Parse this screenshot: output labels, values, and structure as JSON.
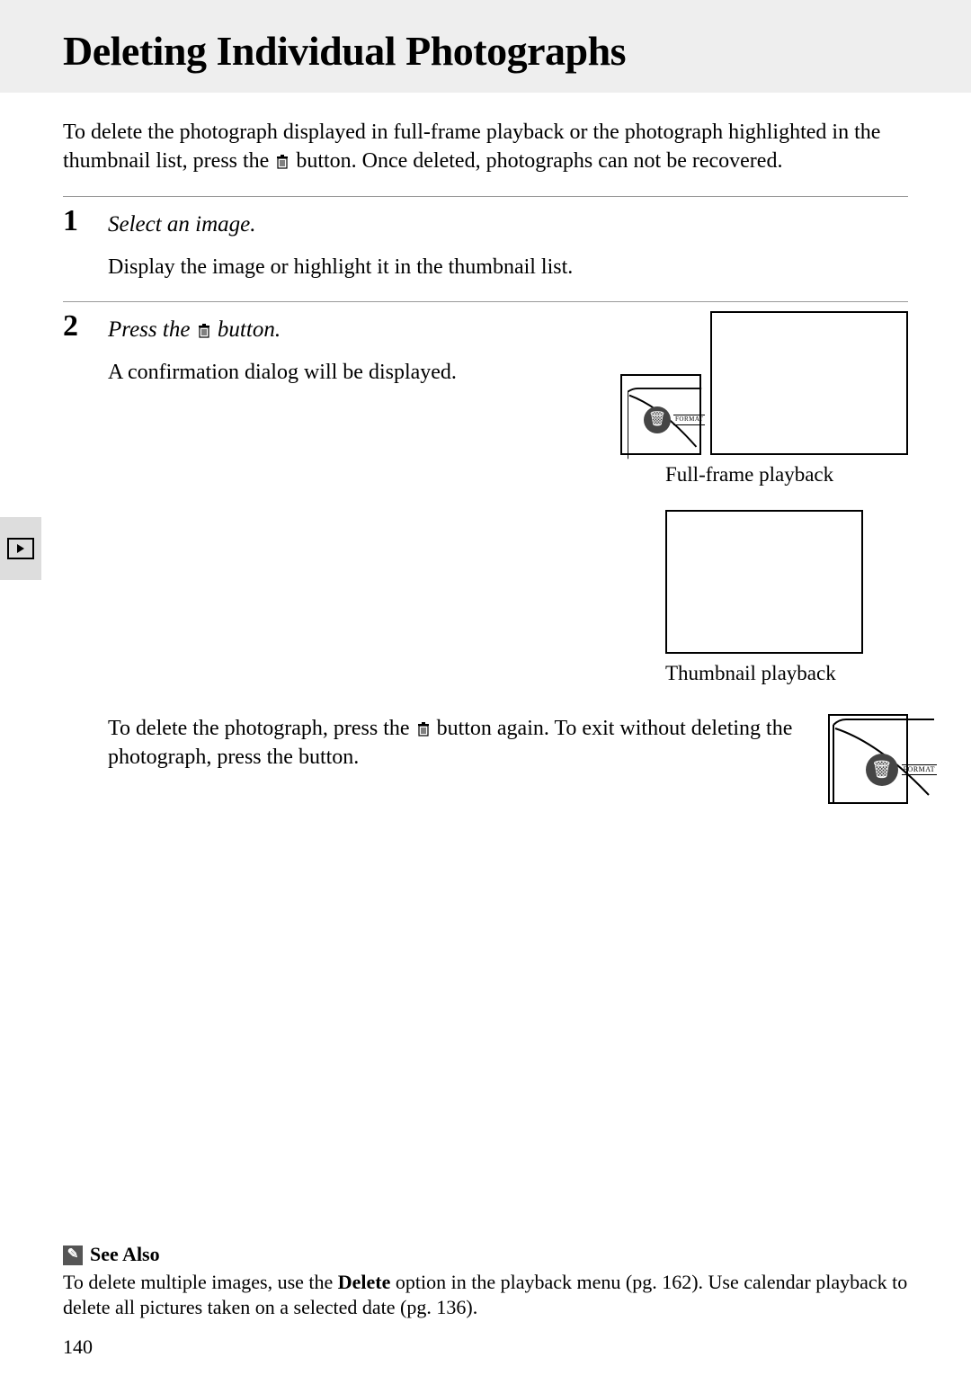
{
  "title": "Deleting Individual Photographs",
  "intro_part1": "To delete the photograph displayed in full-frame playback or the photograph highlighted in the thumbnail list, press the ",
  "intro_part2": " button.  Once deleted, photographs can not be recovered.",
  "steps": {
    "s1": {
      "num": "1",
      "title": "Select an image.",
      "body": "Display the image or highlight it in the thumbnail list."
    },
    "s2": {
      "num": "2",
      "title_pre": "Press the  ",
      "title_post": " button.",
      "body": "A confirmation dialog will be displayed.",
      "caption1": "Full-frame playback",
      "caption2": "Thumbnail playback",
      "cont_pre": "To delete the photograph, press the ",
      "cont_mid": " button again.  To exit without deleting the photograph, press the ",
      "cont_post": " button."
    }
  },
  "format_label": "FORMAT",
  "see_also": {
    "heading": "See Also",
    "text_pre": "To delete multiple images, use the ",
    "text_bold": "Delete",
    "text_post": " option in the playback menu (pg. 162).  Use calendar playback to delete all pictures taken on a selected date (pg. 136)."
  },
  "page_number": "140"
}
